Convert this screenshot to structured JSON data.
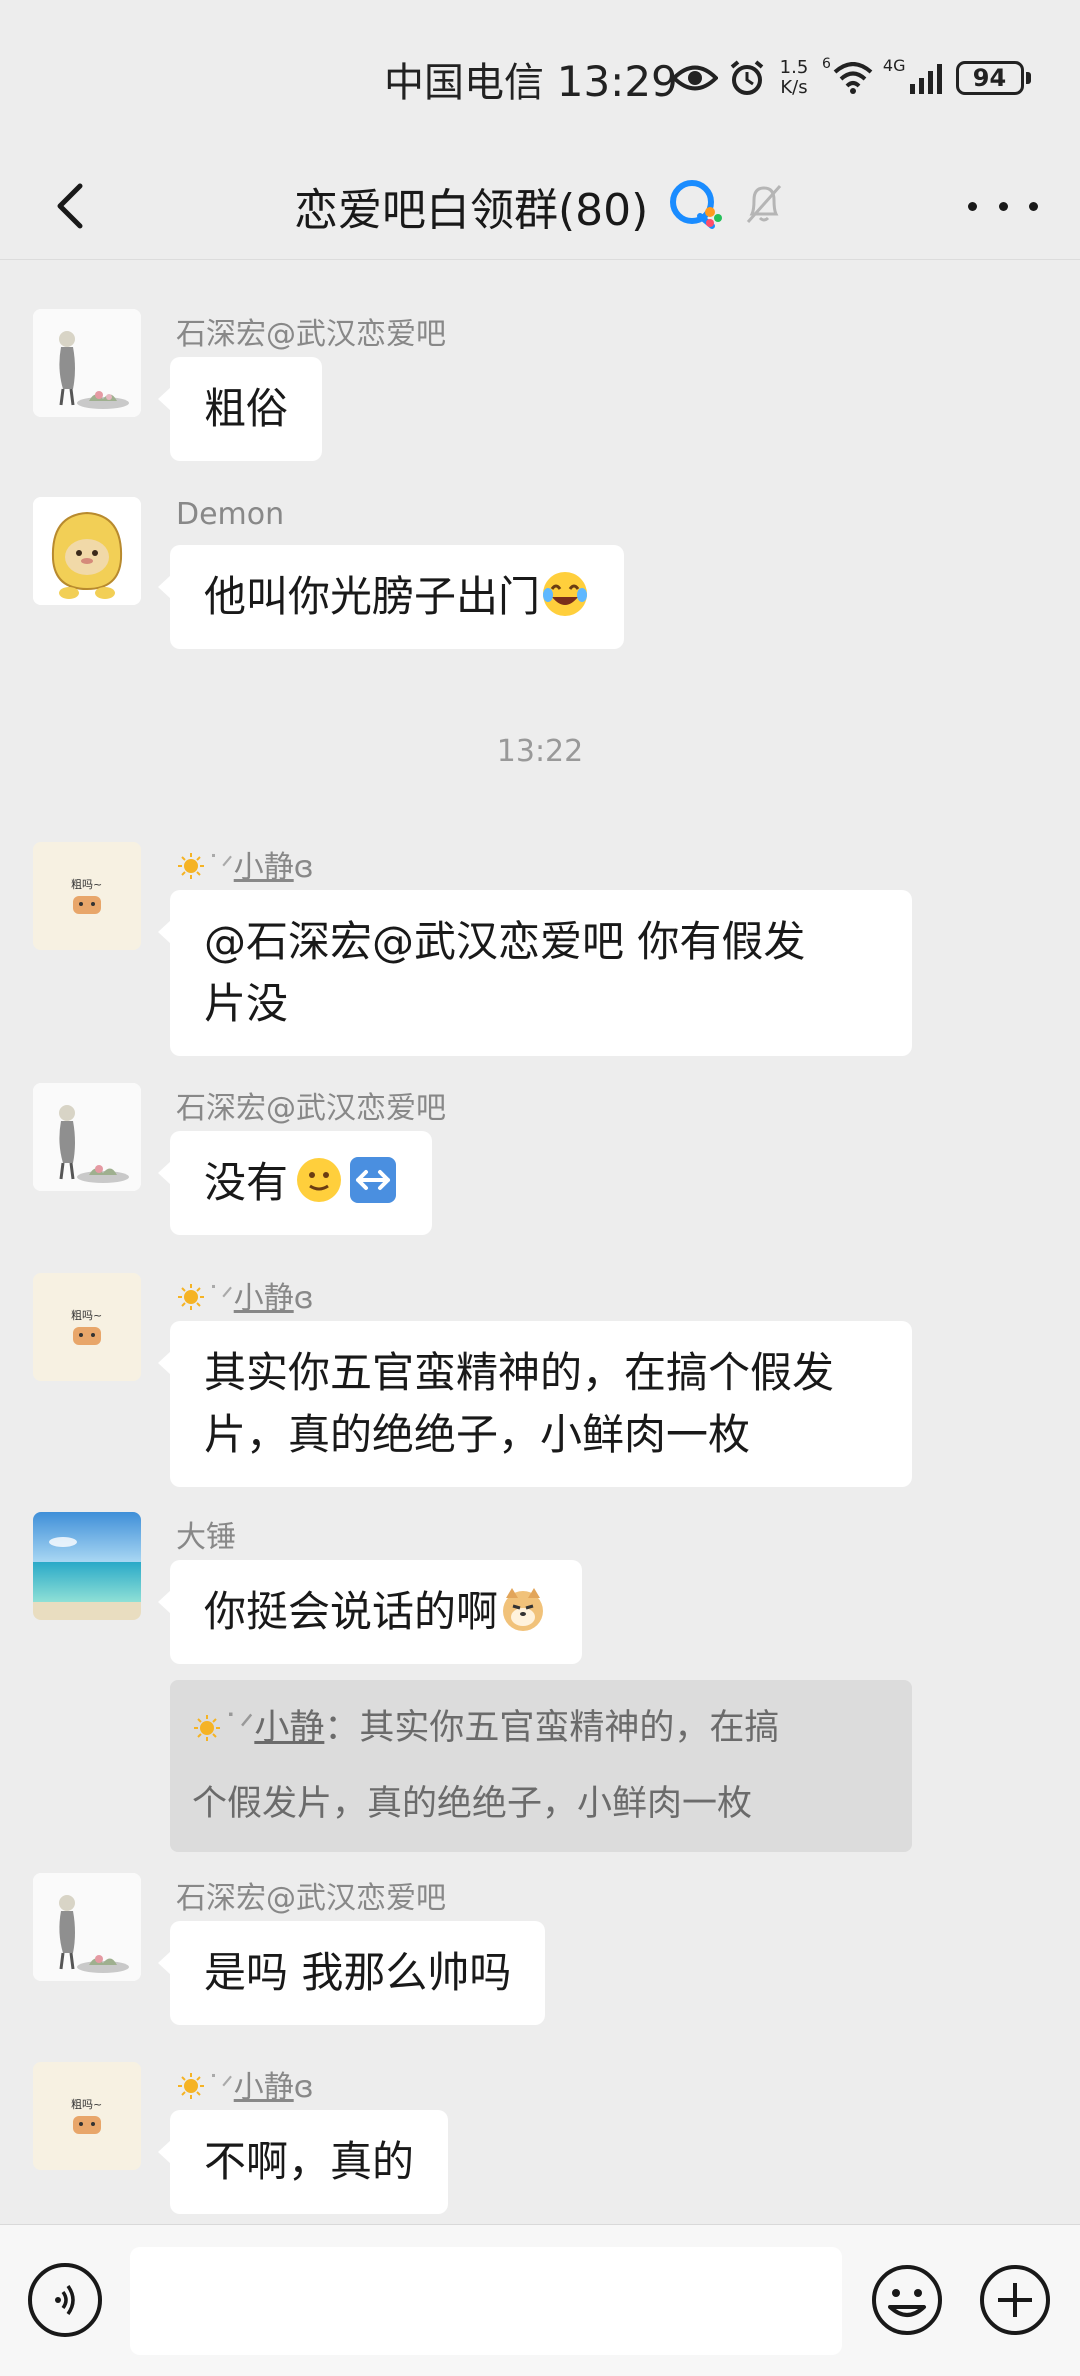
{
  "status_bar": {
    "carrier": "中国电信",
    "time": "13:29",
    "net_speed_value": "1.5",
    "net_speed_unit": "K/s",
    "wifi_label": "6",
    "cell_label": "4G",
    "battery": "94"
  },
  "header": {
    "title": "恋爱吧白领群(80)"
  },
  "messages": [
    {
      "sender": "石深宏@武汉恋爱吧",
      "text": "粗俗"
    },
    {
      "sender": "Demon",
      "text": "他叫你光膀子出门"
    },
    {
      "sender": "小静",
      "sender_suffix": "ɞ",
      "text_line1": "@石深宏@武汉恋爱吧  你有假发",
      "text_line2": "片没"
    },
    {
      "sender": "石深宏@武汉恋爱吧",
      "text": "没有"
    },
    {
      "sender": "小静",
      "sender_suffix": "ɞ",
      "text_line1": "其实你五官蛮精神的，在搞个假发",
      "text_line2": "片，真的绝绝子，小鲜肉一枚"
    },
    {
      "sender": "大锤",
      "text": "你挺会说话的啊",
      "quote_sender": "小静",
      "quote_line1": "：其实你五官蛮精神的，在搞",
      "quote_line2": "个假发片，真的绝绝子，小鲜肉一枚"
    },
    {
      "sender": "石深宏@武汉恋爱吧",
      "text": "是吗 我那么帅吗"
    },
    {
      "sender": "小静",
      "sender_suffix": "ɞ",
      "text": "不啊，真的"
    }
  ],
  "time_separator": "13:22",
  "avatar_labels": {
    "xiaojing": "粗吗~"
  },
  "icons": {
    "back": "chevron-left-icon",
    "group_badge": "qq-chat-icon",
    "mute": "bell-off-icon",
    "more": "more-dots-icon",
    "voice": "voice-icon",
    "emoji": "smiley-icon",
    "plus": "plus-icon"
  },
  "colors": {
    "background": "#ededed",
    "bubble": "#ffffff",
    "quote_bg": "#dcdcdc",
    "sender_text": "#888888"
  }
}
